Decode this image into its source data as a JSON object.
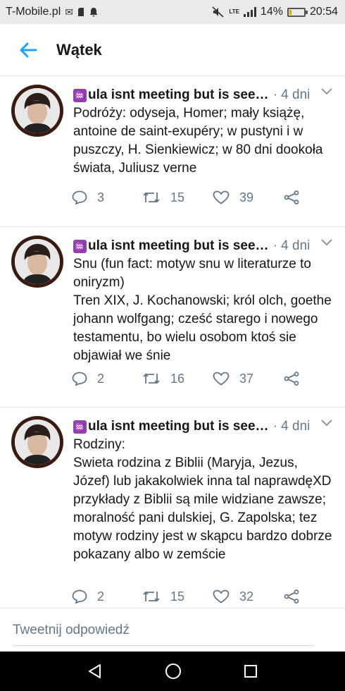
{
  "status": {
    "carrier": "T-Mobile.pl",
    "network": "LTE",
    "battery": "14%",
    "battery_level": 0.14,
    "time": "20:54"
  },
  "header": {
    "title": "Wątek",
    "back_icon": "arrow-left-icon"
  },
  "tweets": [
    {
      "name": "ula isnt meeting but is see…",
      "time": "· 4 dni",
      "text": "Podróży: odyseja, Homer; mały książę, antoine de saint-exupéry; w pustyni i w puszczy, H. Sienkiewicz; w 80 dni dookoła świata, Juliusz verne",
      "replies": "3",
      "retweets": "15",
      "likes": "39"
    },
    {
      "name": "ula isnt meeting but is see…",
      "time": "· 4 dni",
      "text": "Snu (fun fact: motyw snu w literaturze to oniryzm)\nTren XIX, J. Kochanowski; król olch, goethe johann wolfgang; cześć starego i nowego testamentu, bo wielu osobom ktoś sie objawiał we śnie",
      "replies": "2",
      "retweets": "16",
      "likes": "37"
    },
    {
      "name": "ula isnt meeting but is see…",
      "time": "· 4 dni",
      "text": "Rodziny:\nSwieta rodzina z Biblii (Maryja, Jezus, Józef) lub jakakolwiek inna tal naprawdęXD przykłady z Biblii są mile widziane zawsze; moralność pani dulskiej, G. Zapolska; tez motyw rodziny jest w skąpcu bardzo dobrze pokazany albo w zemście",
      "replies": "2",
      "retweets": "15",
      "likes": "32"
    }
  ],
  "reply": {
    "placeholder": "Tweetnij odpowiedź"
  },
  "colors": {
    "accent": "#1da1f2",
    "muted": "#657786",
    "text": "#14171a",
    "divider": "#e1e8ed"
  }
}
